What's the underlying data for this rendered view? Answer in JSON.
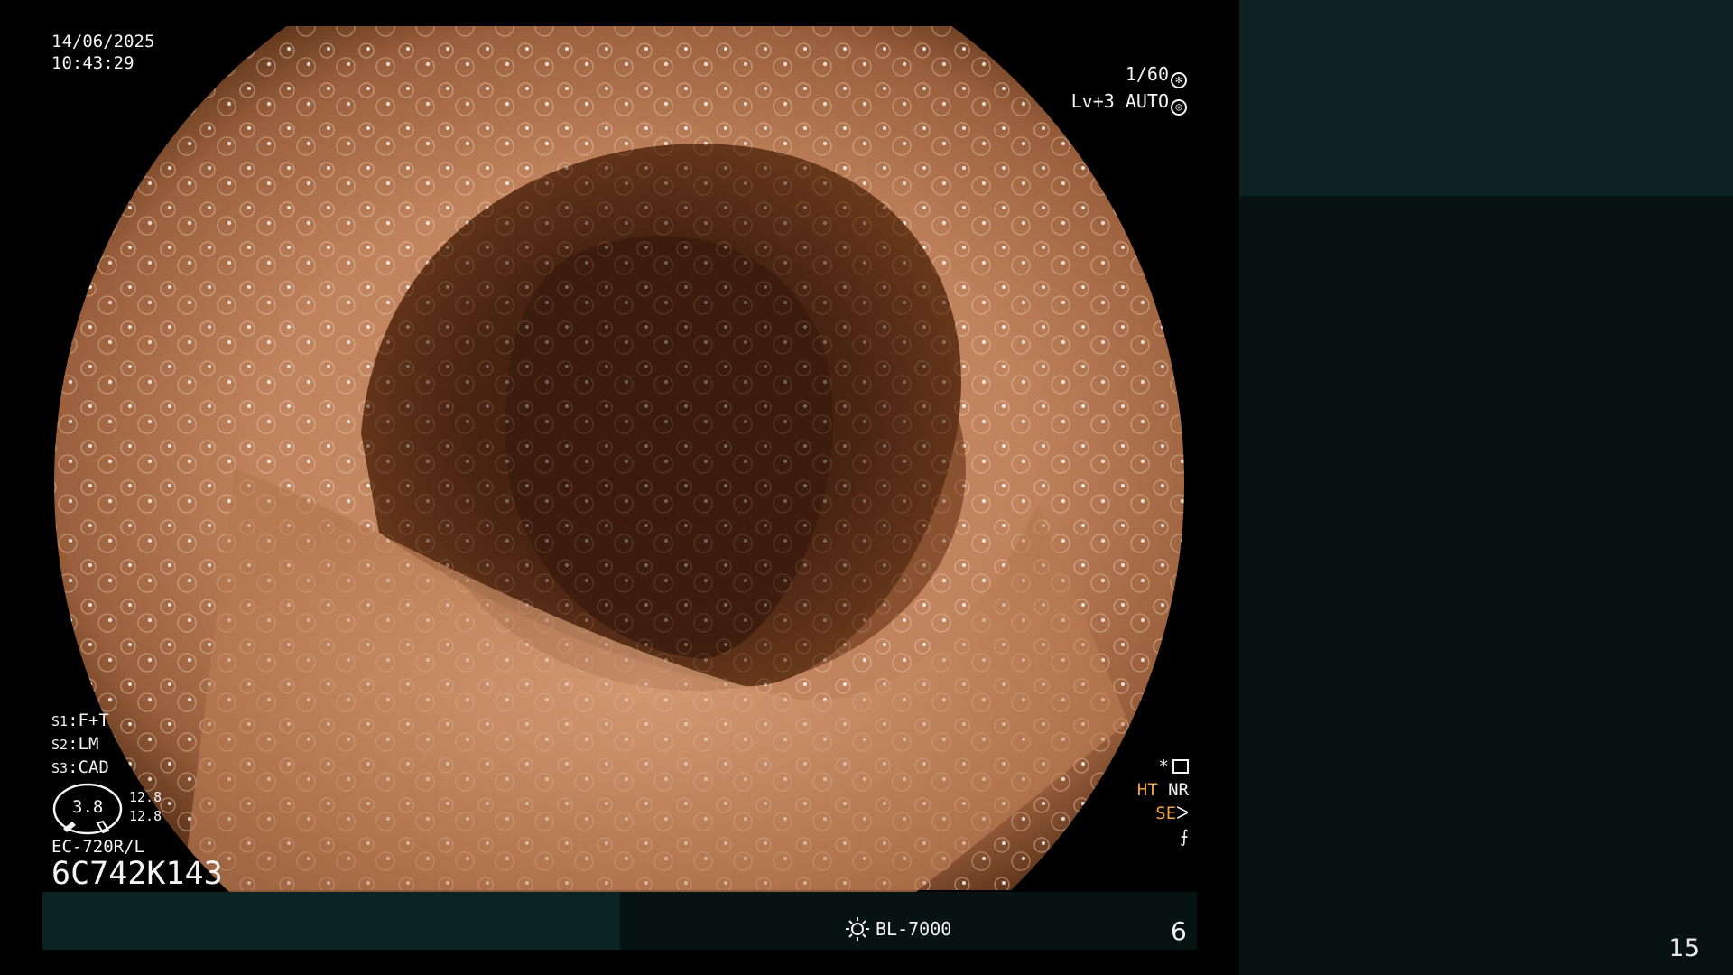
{
  "overlay": {
    "date": "14/06/2025",
    "time": "10:43:29",
    "shutter": "1/60",
    "level_mode": "Lv+3 AUTO",
    "settings": [
      {
        "key": "S1",
        "value": "F+T"
      },
      {
        "key": "S2",
        "value": "LM"
      },
      {
        "key": "S3",
        "value": "CAD"
      }
    ],
    "gauge_value": "3.8",
    "gauge_sub_top": "12.8",
    "gauge_sub_bottom": "12.8",
    "scope_model": "EC-720R/L",
    "serial": "6C742K143",
    "right_marker": "*",
    "ht": "HT",
    "nr": "NR",
    "se": "SE",
    "light_source": "BL-7000",
    "frame_count": "6"
  },
  "slide": {
    "page_number": "15"
  },
  "colors": {
    "amber": "#f0a43a",
    "panel_dark": "#071211",
    "panel_teal": "#0c2222"
  }
}
